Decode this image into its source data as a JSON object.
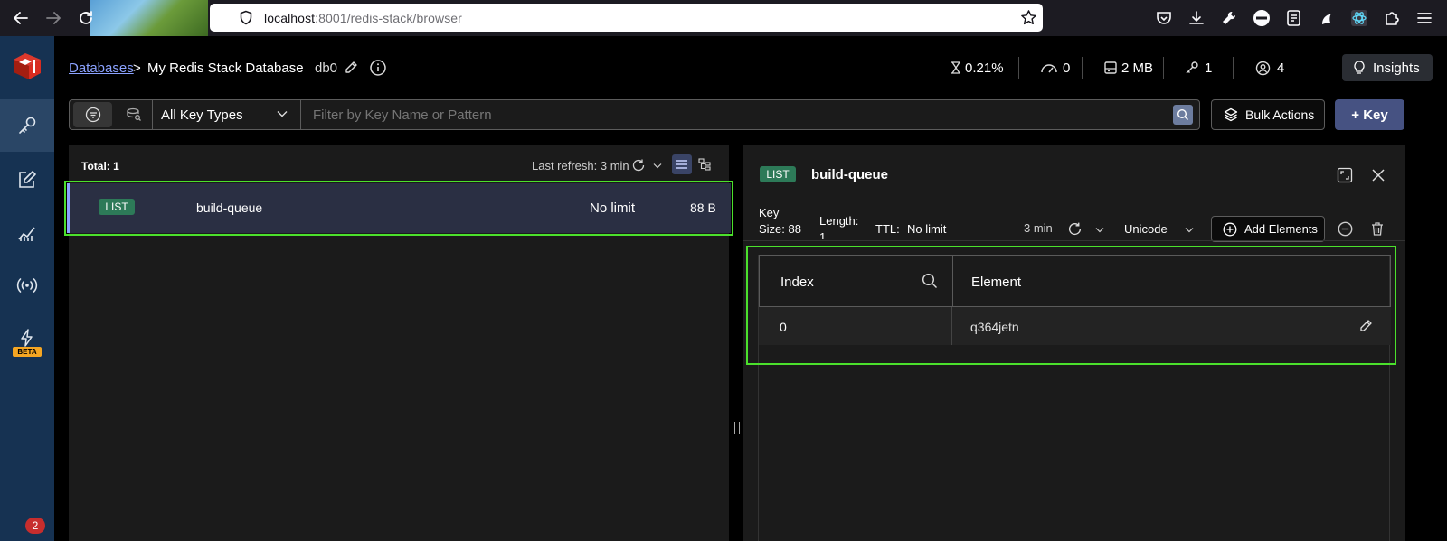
{
  "browser": {
    "url_host": "localhost",
    "url_path": ":8001/redis-stack/browser",
    "notification_count": "2"
  },
  "header": {
    "breadcrumb_root": "Databases",
    "breadcrumb_sep": ">",
    "database_name": "My Redis Stack Database",
    "db_index": "db0",
    "stats": {
      "cpu": "0.21%",
      "ops": "0",
      "memory": "2 MB",
      "keys": "1",
      "clients": "4"
    },
    "insights_label": "Insights"
  },
  "toolbar": {
    "key_type_value": "All Key Types",
    "filter_placeholder": "Filter by Key Name or Pattern",
    "bulk_actions_label": "Bulk Actions",
    "add_key_label": "+ Key"
  },
  "key_list": {
    "total_label": "Total: 1",
    "last_refresh": "Last refresh: 3 min",
    "rows": [
      {
        "type": "LIST",
        "name": "build-queue",
        "ttl": "No limit",
        "size": "88 B"
      }
    ]
  },
  "key_details": {
    "type": "LIST",
    "name": "build-queue",
    "key_size_label": "Key",
    "key_size_value": "Size: 88",
    "length_label": "Length:",
    "length_value": "1",
    "ttl_label": "TTL:",
    "ttl_value": "No limit",
    "refresh_time": "3 min",
    "format": "Unicode",
    "add_elements_label": "Add Elements",
    "table": {
      "columns": [
        "Index",
        "Element"
      ],
      "rows": [
        {
          "index": "0",
          "element": "q364jetn"
        }
      ]
    }
  },
  "sidebar": {
    "beta_label": "BETA"
  },
  "colors": {
    "sidebar_bg": "#163252",
    "highlight_green": "#4be12c",
    "list_tag": "#2d7a58",
    "add_key_bg": "#465282"
  }
}
